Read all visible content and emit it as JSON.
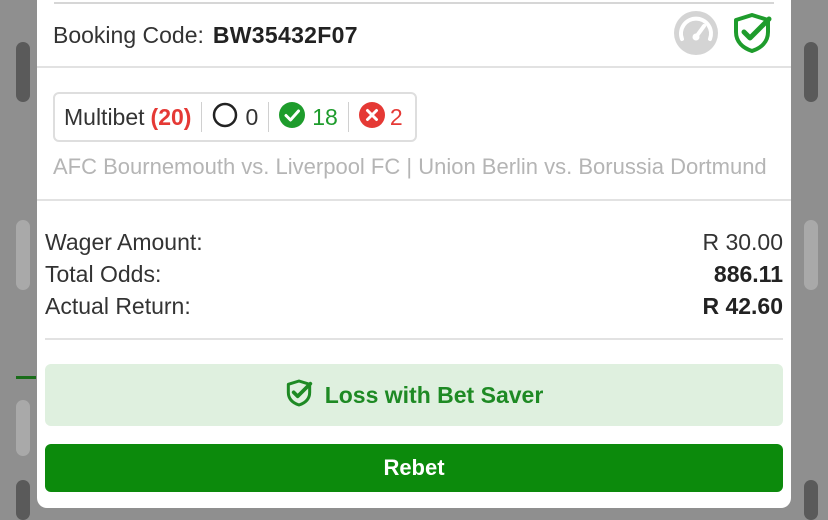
{
  "booking": {
    "label": "Booking Code:",
    "code": "BW35432F07"
  },
  "bet": {
    "type_label": "Multibet",
    "selections": "(20)",
    "pending": "0",
    "won": "18",
    "lost": "2",
    "matches": "AFC Bournemouth vs. Liverpool FC | Union Berlin vs. Borussia Dortmund"
  },
  "summary": {
    "wager_label": "Wager Amount:",
    "wager_value": "R 30.00",
    "odds_label": "Total Odds:",
    "odds_value": "886.11",
    "return_label": "Actual Return:",
    "return_value": "R 42.60"
  },
  "actions": {
    "saver_label": "Loss with Bet Saver",
    "rebet_label": "Rebet"
  },
  "colors": {
    "brand_green": "#0c8a0c",
    "loss_red": "#e53935",
    "saver_bg": "#dff0df"
  },
  "icons": [
    "speedometer-icon",
    "shield-check-icon",
    "empty-circle-icon",
    "check-circle-icon",
    "x-circle-icon"
  ]
}
